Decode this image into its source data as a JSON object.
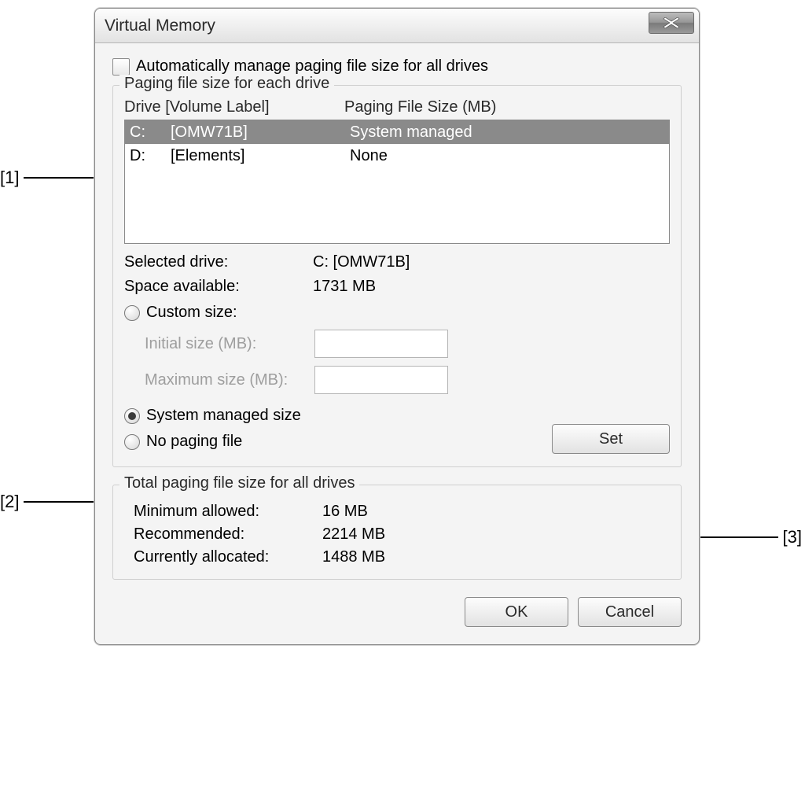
{
  "dialog": {
    "title": "Virtual Memory",
    "auto_manage_label": "Automatically manage paging file size for all drives"
  },
  "group1": {
    "legend": "Paging file size for each drive",
    "header_drive": "Drive  [Volume Label]",
    "header_size": "Paging File Size (MB)",
    "drives": [
      {
        "letter": "C:",
        "label": "[OMW71B]",
        "size": "System managed",
        "selected": true
      },
      {
        "letter": "D:",
        "label": "[Elements]",
        "size": "None",
        "selected": false
      }
    ],
    "selected_drive_label": "Selected drive:",
    "selected_drive_value": "C:  [OMW71B]",
    "space_available_label": "Space available:",
    "space_available_value": "1731 MB",
    "radio_custom": "Custom size:",
    "initial_size_label": "Initial size (MB):",
    "maximum_size_label": "Maximum size (MB):",
    "radio_system": "System managed size",
    "radio_none": "No paging file",
    "set_button": "Set"
  },
  "group2": {
    "legend": "Total paging file size for all drives",
    "minimum_label": "Minimum allowed:",
    "minimum_value": "16 MB",
    "recommended_label": "Recommended:",
    "recommended_value": "2214 MB",
    "current_label": "Currently allocated:",
    "current_value": "1488 MB"
  },
  "footer": {
    "ok": "OK",
    "cancel": "Cancel"
  },
  "callouts": {
    "c1": "[1]",
    "c2": "[2]",
    "c3": "[3]"
  }
}
